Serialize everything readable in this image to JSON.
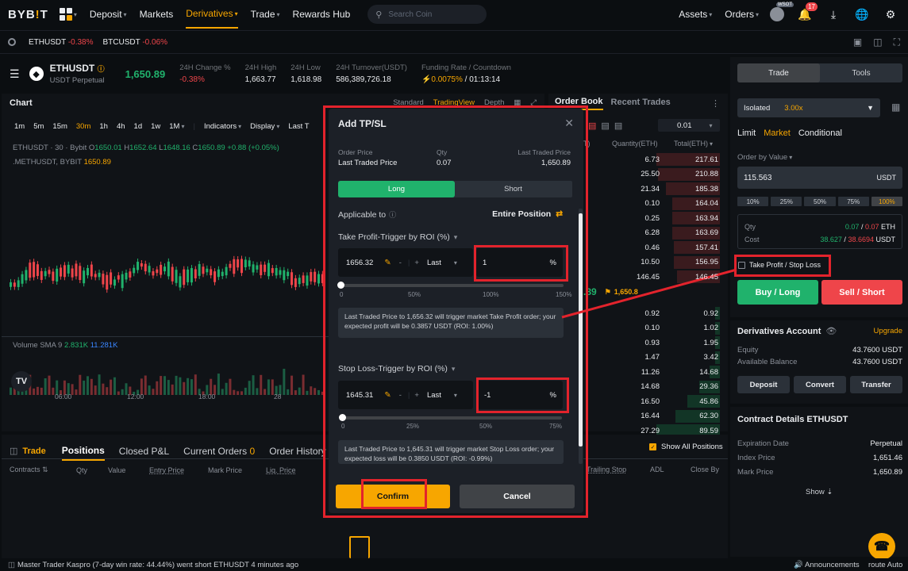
{
  "nav": {
    "logo": "BYB",
    "logo_i": "!",
    "logo_end": "T",
    "items": [
      "Deposit",
      "Markets",
      "Derivatives",
      "Trade",
      "Rewards Hub"
    ],
    "search_placeholder": "Search Coin",
    "assets": "Assets",
    "orders": "Orders",
    "badge_wsot": "WSOT",
    "notif_count": "17"
  },
  "ticker": [
    {
      "sym": "ETHUSDT",
      "chg": "-0.38%"
    },
    {
      "sym": "BTCUSDT",
      "chg": "-0.06%"
    }
  ],
  "symbol": {
    "name": "ETHUSDT",
    "sub": "USDT Perpetual",
    "price": "1,650.89",
    "stats": [
      {
        "label": "24H Change %",
        "value": "-0.38%"
      },
      {
        "label": "24H High",
        "value": "1,663.77"
      },
      {
        "label": "24H Low",
        "value": "1,618.98"
      },
      {
        "label": "24H Turnover(USDT)",
        "value": "586,389,726.18"
      }
    ],
    "funding_label": "Funding Rate / Countdown",
    "funding_rate": "0.0075%",
    "countdown": "/ 01:13:14"
  },
  "chart": {
    "title": "Chart",
    "views": [
      "Standard",
      "TradingView",
      "Depth"
    ],
    "intervals": [
      "1m",
      "5m",
      "15m",
      "30m",
      "1h",
      "4h",
      "1d",
      "1w",
      "1M"
    ],
    "indicators": "Indicators",
    "display": "Display",
    "last": "Last T",
    "ohlc_line1": "ETHUSDT · 30 · Bybit",
    "o": "1650.01",
    "h": "1652.64",
    "l": "1648.16",
    "c": "1650.89",
    "chg": "+0.88 (+0.05%)",
    "mark_line": ".METHUSDT, BYBIT",
    "mark_val": "1650.89",
    "volume_label": "Volume SMA 9",
    "vol1": "2.831K",
    "vol2": "11.281K",
    "time_labels": [
      "06:00",
      "12:00",
      "18:00",
      "28"
    ]
  },
  "orderbook": {
    "tabs": [
      "Order Book",
      "Recent Trades"
    ],
    "precision": "0.01",
    "col_qty": "Quantity(ETH)",
    "col_total": "Total(ETH)",
    "col_price_partial": "T)",
    "asks": [
      {
        "qty": "6.73",
        "total": "217.61"
      },
      {
        "qty": "25.50",
        "total": "210.88"
      },
      {
        "qty": "21.34",
        "total": "185.38"
      },
      {
        "qty": "0.10",
        "total": "164.04"
      },
      {
        "qty": "0.25",
        "total": "163.94"
      },
      {
        "qty": "6.28",
        "total": "163.69"
      },
      {
        "qty": "0.46",
        "total": "157.41"
      },
      {
        "qty": "10.50",
        "total": "156.95"
      },
      {
        "qty": "146.45",
        "total": "146.45"
      }
    ],
    "mid_price": ".89",
    "mid_mark": "1,650.8",
    "bids": [
      {
        "qty": "0.92",
        "total": "0.92"
      },
      {
        "qty": "0.10",
        "total": "1.02"
      },
      {
        "qty": "0.93",
        "total": "1.95"
      },
      {
        "qty": "1.47",
        "total": "3.42"
      },
      {
        "qty": "11.26",
        "total": "14.68"
      },
      {
        "qty": "14.68",
        "total": "29.36"
      },
      {
        "qty": "16.50",
        "total": "45.86"
      },
      {
        "qty": "16.44",
        "total": "62.30"
      },
      {
        "qty": "27.29",
        "total": "89.59"
      }
    ]
  },
  "right": {
    "tabs": [
      "Trade",
      "Tools"
    ],
    "margin_mode": "Isolated",
    "leverage": "3.00x",
    "order_types": [
      "Limit",
      "Market",
      "Conditional"
    ],
    "order_by": "Order by Value",
    "value": "115.563",
    "unit": "USDT",
    "pcts": [
      "10%",
      "25%",
      "50%",
      "75%",
      "100%"
    ],
    "qty_label": "Qty",
    "qty_green": "0.07",
    "qty_red": "0.07",
    "qty_unit": "ETH",
    "cost_label": "Cost",
    "cost_green": "38.627",
    "cost_red": "38.6694",
    "cost_unit": "USDT",
    "tpsl_label": "Take Profit / Stop Loss",
    "buy": "Buy / Long",
    "sell": "Sell / Short",
    "acct_title": "Derivatives Account",
    "upgrade": "Upgrade",
    "equity_label": "Equity",
    "equity": "43.7600 USDT",
    "avail_label": "Available Balance",
    "avail": "43.7600 USDT",
    "acct_btns": [
      "Deposit",
      "Convert",
      "Transfer"
    ],
    "contract_title": "Contract Details ETHUSDT",
    "details": [
      {
        "label": "Expiration Date",
        "value": "Perpetual"
      },
      {
        "label": "Index Price",
        "value": "1,651.46"
      },
      {
        "label": "Mark Price",
        "value": "1,650.89"
      }
    ],
    "show": "Show"
  },
  "bottom": {
    "trade": "Trade",
    "tabs": [
      "Positions",
      "Closed P&L",
      "Current Orders",
      "Order History",
      "T"
    ],
    "current_orders_count": "0",
    "show_all": "Show All Positions",
    "cols": [
      "Contracts",
      "Qty",
      "Value",
      "Entry Price",
      "Mark Price",
      "Liq. Price"
    ],
    "cols_right": [
      "Trailing Stop",
      "ADL",
      "Close By"
    ]
  },
  "footer": {
    "msg": "Master Trader Kaspro (7-day win rate: 44.44%) went short ETHUSDT 4 minutes ago",
    "announcements": "Announcements",
    "route": "route Auto"
  },
  "modal": {
    "title": "Add TP/SL",
    "order_price_label": "Order Price",
    "order_price": "Last Traded Price",
    "qty_label": "Qty",
    "qty": "0.07",
    "ltp_label": "Last Traded Price",
    "ltp": "1,650.89",
    "tab_long": "Long",
    "tab_short": "Short",
    "applicable_label": "Applicable to",
    "applicable_value": "Entire Position",
    "tp_title": "Take Profit-Trigger by ROI (%)",
    "tp_price": "1656.32",
    "tp_trigger": "Last",
    "tp_roi": "1",
    "pct": "%",
    "tp_ticks": [
      "0",
      "50%",
      "100%",
      "150%"
    ],
    "tp_info": "Last Traded Price to 1,656.32 will trigger market Take Profit order; your expected profit will be 0.3857 USDT (ROI: 1.00%)",
    "sl_title": "Stop Loss-Trigger by ROI (%)",
    "sl_price": "1645.31",
    "sl_trigger": "Last",
    "sl_roi": "-1",
    "sl_ticks": [
      "0",
      "25%",
      "50%",
      "75%"
    ],
    "sl_info": "Last Traded Price to 1,645.31 will trigger market Stop Loss order; your expected loss will be 0.3850 USDT (ROI: -0.99%)",
    "confirm": "Confirm",
    "cancel": "Cancel"
  },
  "colors": {
    "accent": "#f7a600",
    "green": "#20b26c",
    "red": "#ef454a",
    "highlight": "#e3232c"
  }
}
